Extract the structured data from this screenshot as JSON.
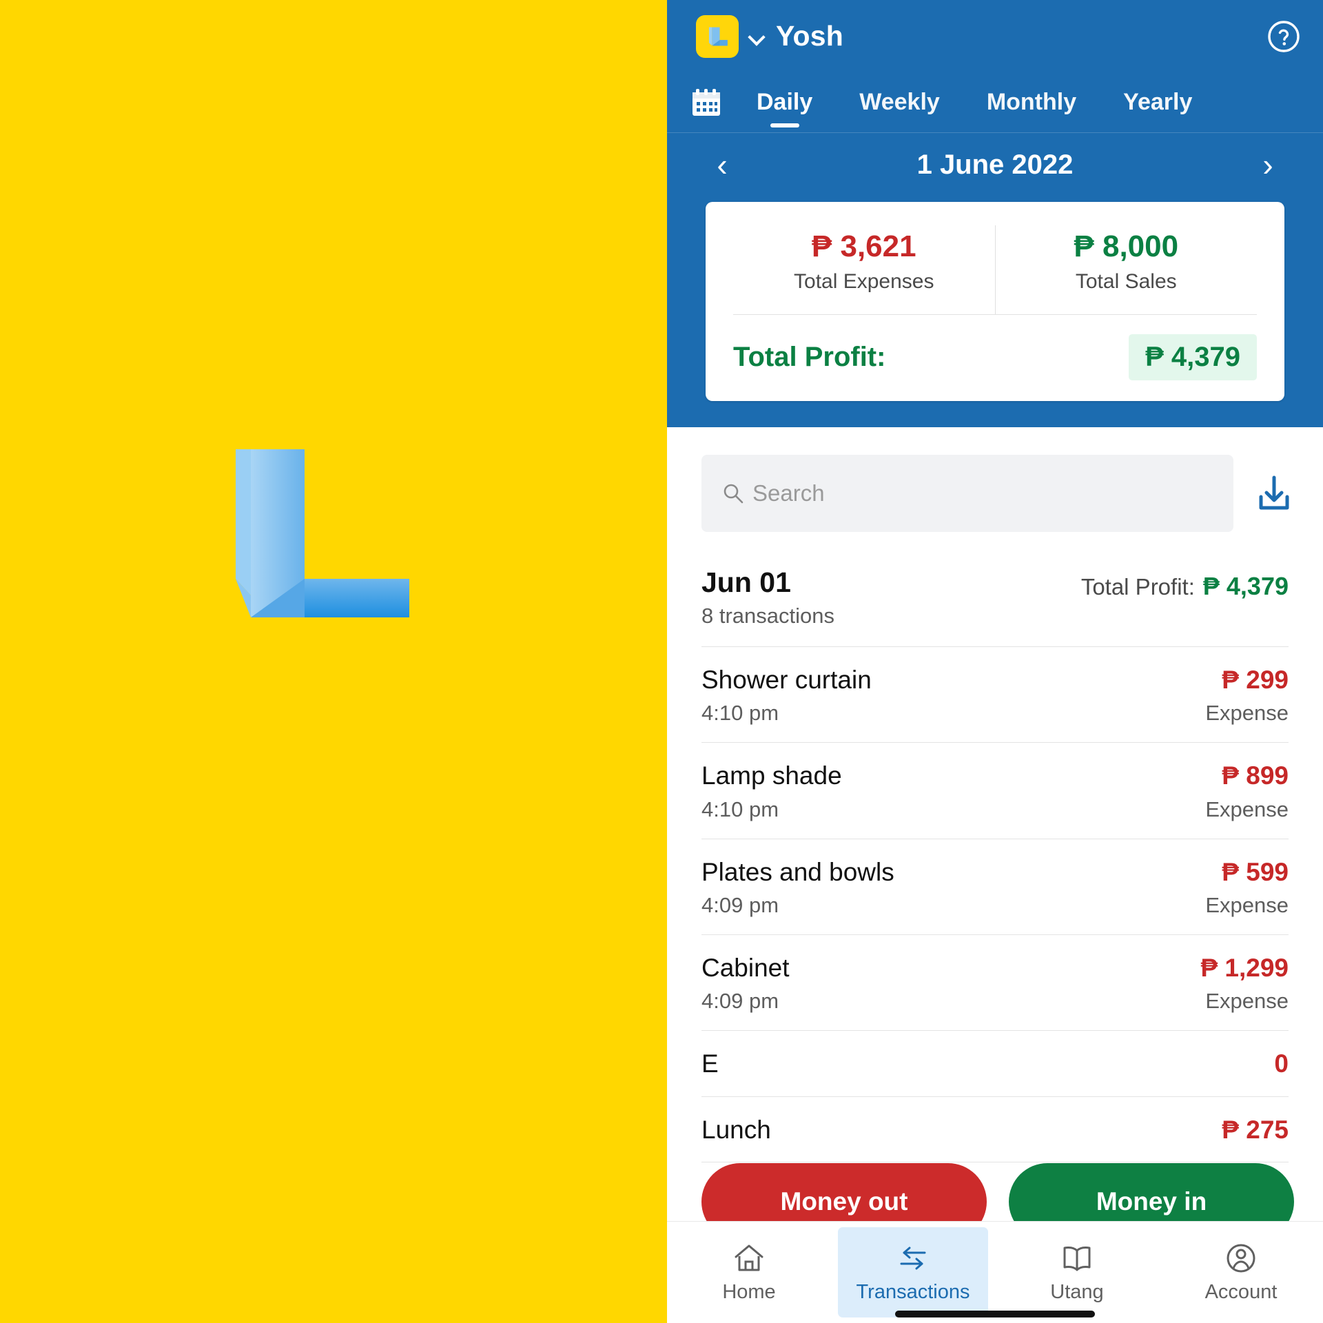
{
  "brand": {
    "logo_icon": "letter-l-logo",
    "background_color": "#FFD700",
    "logo_color": "#5BA9E8"
  },
  "header": {
    "store_name": "Yosh",
    "badge_icon": "letter-l-logo",
    "dropdown_icon": "chevron-down-icon",
    "help_icon": "help-circle-icon",
    "background_color": "#1C6CB0"
  },
  "tabs": {
    "calendar_icon": "calendar-icon",
    "items": [
      {
        "label": "Daily",
        "active": true
      },
      {
        "label": "Weekly",
        "active": false
      },
      {
        "label": "Monthly",
        "active": false
      },
      {
        "label": "Yearly",
        "active": false
      }
    ]
  },
  "date_nav": {
    "prev_icon": "‹",
    "label": "1 June 2022",
    "next_icon": "›"
  },
  "summary": {
    "expenses_amount": "₱ 3,621",
    "expenses_label": "Total Expenses",
    "sales_amount": "₱ 8,000",
    "sales_label": "Total Sales",
    "profit_label": "Total Profit:",
    "profit_amount": "₱ 4,379",
    "expense_color": "#C62828",
    "sales_color": "#0B8043",
    "profit_highlight": "#E3F7EC"
  },
  "search": {
    "placeholder": "Search",
    "value": "",
    "icon": "search-icon",
    "download_icon": "download-icon"
  },
  "day_group": {
    "date": "Jun 01",
    "count": "8 transactions",
    "profit_label": "Total Profit:",
    "profit_amount": "₱ 4,379"
  },
  "transactions": [
    {
      "title": "Shower curtain",
      "time": "4:10 pm",
      "amount": "₱ 299",
      "type": "Expense"
    },
    {
      "title": "Lamp shade",
      "time": "4:10 pm",
      "amount": "₱ 899",
      "type": "Expense"
    },
    {
      "title": "Plates and bowls",
      "time": "4:09 pm",
      "amount": "₱ 599",
      "type": "Expense"
    },
    {
      "title": "Cabinet",
      "time": "4:09 pm",
      "amount": "₱ 1,299",
      "type": "Expense"
    },
    {
      "title": "E",
      "time": "",
      "amount": "0",
      "type": ""
    },
    {
      "title": "Lunch",
      "time": "",
      "amount": "₱ 275",
      "type": ""
    }
  ],
  "actions": {
    "money_out": "Money out",
    "money_in": "Money in",
    "money_out_color": "#CC2B2B",
    "money_in_color": "#0E8043"
  },
  "bottom_nav": {
    "items": [
      {
        "label": "Home",
        "icon": "home-icon",
        "active": false
      },
      {
        "label": "Transactions",
        "icon": "transfer-arrows-icon",
        "active": true
      },
      {
        "label": "Utang",
        "icon": "book-icon",
        "active": false
      },
      {
        "label": "Account",
        "icon": "user-circle-icon",
        "active": false
      }
    ]
  }
}
